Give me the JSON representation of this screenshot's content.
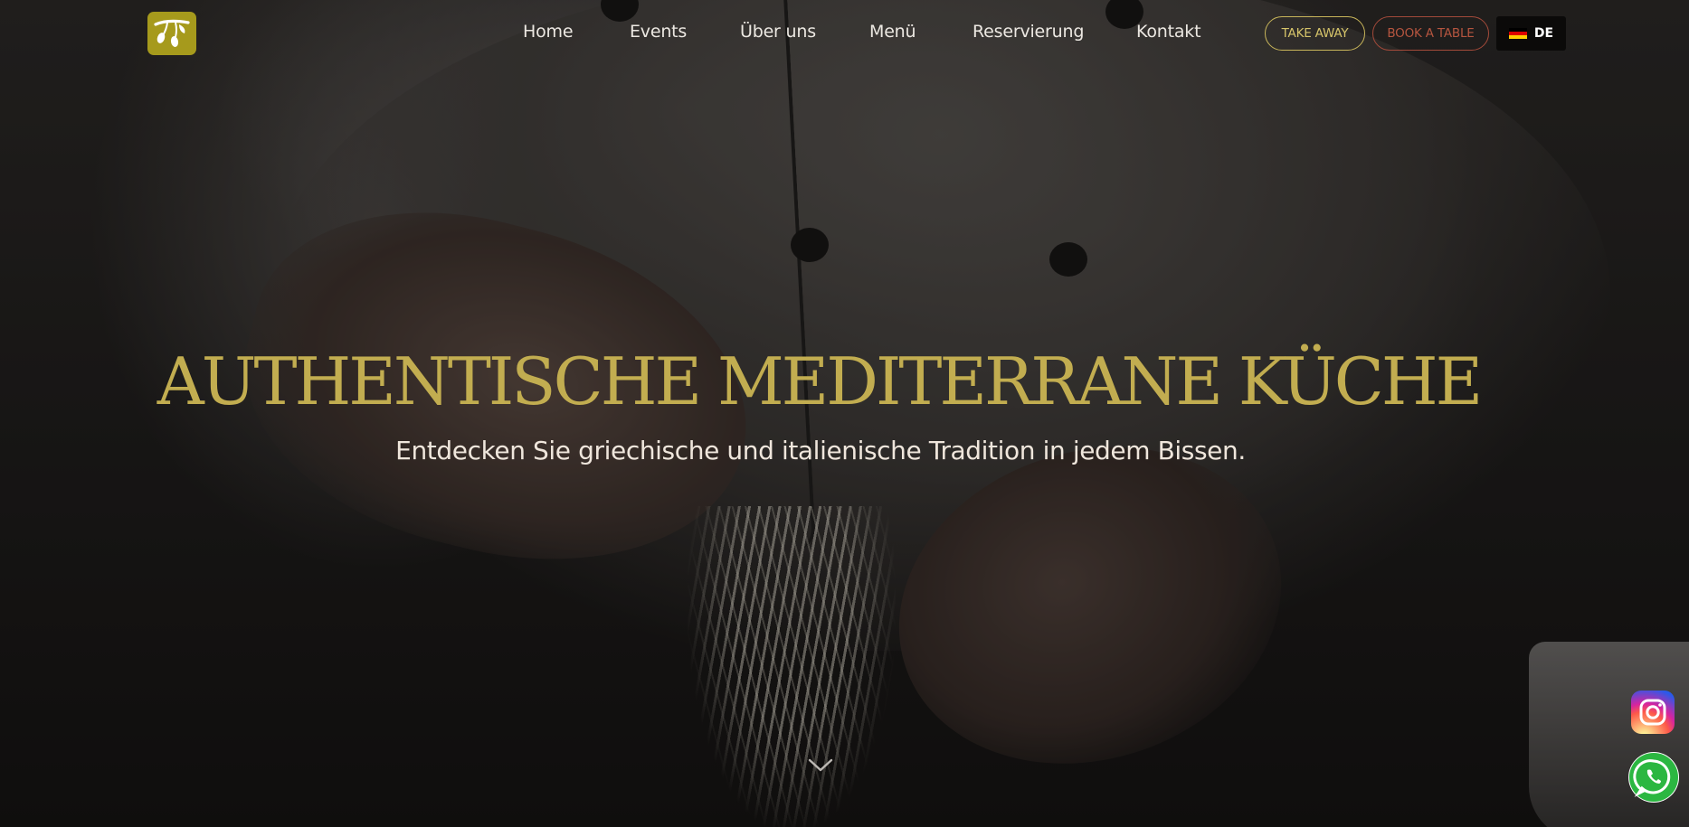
{
  "site": {
    "logo_icon": "olive-branch-icon",
    "accent_color": "#c2ad50",
    "logo_color": "#a69a1c"
  },
  "nav": {
    "items": [
      {
        "label": "Home"
      },
      {
        "label": "Events"
      },
      {
        "label": "Über uns"
      },
      {
        "label": "Menü"
      },
      {
        "label": "Reservierung"
      },
      {
        "label": "Kontakt"
      }
    ]
  },
  "actions": {
    "take_away_label": "TAKE AWAY",
    "take_away_color": "#c8b55a",
    "book_table_label": "BOOK A TABLE",
    "book_table_color": "#a34a3a"
  },
  "language": {
    "code": "DE",
    "flag_icon": "german-flag-icon"
  },
  "hero": {
    "headline": "AUTHENTISCHE MEDITERRANE KÜCHE",
    "subline": "Entdecken Sie griechische und italienische Tradition in jedem Bissen.",
    "scroll_icon": "chevron-down-icon"
  },
  "social": {
    "instagram_icon": "instagram-icon",
    "whatsapp_icon": "whatsapp-icon"
  }
}
